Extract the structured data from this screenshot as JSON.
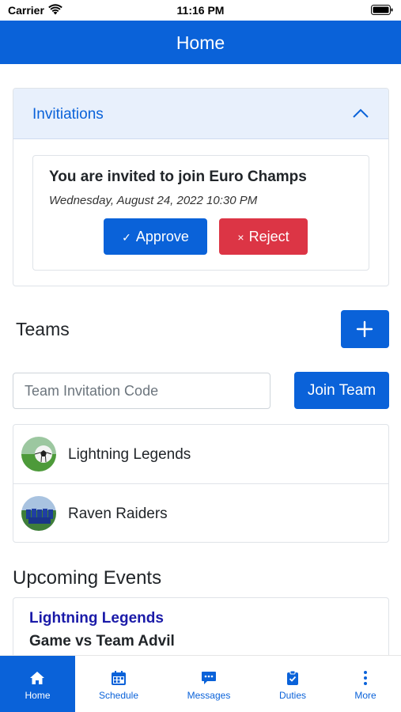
{
  "status_bar": {
    "carrier": "Carrier",
    "time": "11:16 PM"
  },
  "nav": {
    "title": "Home"
  },
  "invitations": {
    "header": "Invitiations",
    "message": "You are invited to join Euro Champs",
    "date": "Wednesday, August 24, 2022 10:30 PM",
    "approve_glyph": "✓",
    "approve_label": "Approve",
    "reject_glyph": "×",
    "reject_label": "Reject"
  },
  "teams": {
    "heading": "Teams",
    "invite_code_placeholder": "Team Invitation Code",
    "join_label": "Join Team",
    "items": [
      {
        "name": "Lightning Legends"
      },
      {
        "name": "Raven Raiders"
      }
    ]
  },
  "events": {
    "heading": "Upcoming Events",
    "items": [
      {
        "team": "Lightning Legends",
        "title": "Game vs Team Advil"
      }
    ]
  },
  "tab_bar": {
    "items": [
      {
        "label": "Home",
        "icon": "home-icon",
        "active": true
      },
      {
        "label": "Schedule",
        "icon": "calendar-icon",
        "active": false
      },
      {
        "label": "Messages",
        "icon": "chat-icon",
        "active": false
      },
      {
        "label": "Duties",
        "icon": "clipboard-icon",
        "active": false
      },
      {
        "label": "More",
        "icon": "more-vertical-icon",
        "active": false
      }
    ]
  },
  "colors": {
    "primary": "#0a62d9",
    "danger": "#dc3545",
    "event_team": "#1a1aa8"
  }
}
